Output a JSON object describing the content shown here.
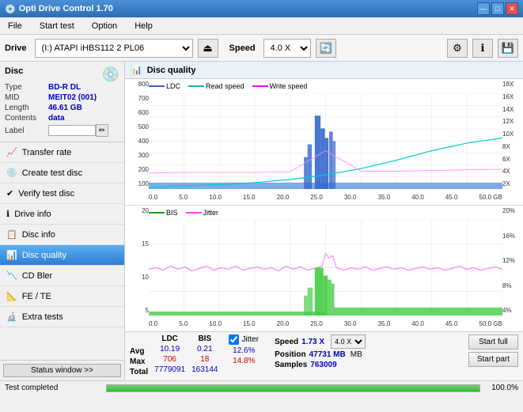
{
  "titleBar": {
    "title": "Opti Drive Control 1.70",
    "icon": "💿",
    "controls": [
      "—",
      "□",
      "✕"
    ]
  },
  "menuBar": {
    "items": [
      "File",
      "Start test",
      "Option",
      "Help"
    ]
  },
  "toolbar": {
    "driveLabel": "Drive",
    "driveValue": "(I:)  ATAPI iHBS112  2 PL06",
    "speedLabel": "Speed",
    "speedValue": "4.0 X"
  },
  "sidebar": {
    "discSection": "Disc",
    "discInfo": {
      "typeLabel": "Type",
      "typeValue": "BD-R DL",
      "midLabel": "MID",
      "midValue": "MEIT02 (001)",
      "lengthLabel": "Length",
      "lengthValue": "46.61 GB",
      "contentsLabel": "Contents",
      "contentsValue": "data",
      "labelLabel": "Label"
    },
    "navItems": [
      {
        "id": "transfer-rate",
        "label": "Transfer rate",
        "icon": "📈"
      },
      {
        "id": "create-test-disc",
        "label": "Create test disc",
        "icon": "💿"
      },
      {
        "id": "verify-test-disc",
        "label": "Verify test disc",
        "icon": "✔"
      },
      {
        "id": "drive-info",
        "label": "Drive info",
        "icon": "ℹ"
      },
      {
        "id": "disc-info",
        "label": "Disc info",
        "icon": "📋"
      },
      {
        "id": "disc-quality",
        "label": "Disc quality",
        "icon": "📊",
        "active": true
      },
      {
        "id": "cd-bler",
        "label": "CD Bler",
        "icon": "📉"
      },
      {
        "id": "fe-te",
        "label": "FE / TE",
        "icon": "📐"
      },
      {
        "id": "extra-tests",
        "label": "Extra tests",
        "icon": "🔬"
      }
    ],
    "statusWindow": "Status window >>",
    "testCompleted": "Test completed"
  },
  "discQuality": {
    "title": "Disc quality",
    "legendTop": {
      "ldc": "LDC",
      "readSpeed": "Read speed",
      "writeSpeed": "Write speed"
    },
    "legendBottom": {
      "bis": "BIS",
      "jitter": "Jitter"
    },
    "topChart": {
      "yMax": 800,
      "yLabels": [
        "800",
        "700",
        "600",
        "500",
        "400",
        "300",
        "200",
        "100"
      ],
      "yLabelsRight": [
        "18X",
        "16X",
        "14X",
        "12X",
        "10X",
        "8X",
        "6X",
        "4X",
        "2X"
      ],
      "xLabels": [
        "0.0",
        "5.0",
        "10.0",
        "15.0",
        "20.0",
        "25.0",
        "30.0",
        "35.0",
        "40.0",
        "45.0",
        "50.0 GB"
      ]
    },
    "bottomChart": {
      "yMax": 20,
      "yLabels": [
        "20",
        "15",
        "10",
        "5"
      ],
      "yLabelsRight": [
        "20%",
        "16%",
        "12%",
        "8%",
        "4%"
      ],
      "xLabels": [
        "0.0",
        "5.0",
        "10.0",
        "15.0",
        "20.0",
        "25.0",
        "30.0",
        "35.0",
        "40.0",
        "45.0",
        "50.0 GB"
      ]
    },
    "stats": {
      "headers": [
        "LDC",
        "BIS",
        "",
        "Jitter",
        "Speed"
      ],
      "avg": {
        "ldc": "10.19",
        "bis": "0.21",
        "jitter": "12.6%",
        "speed": "1.73 X",
        "speedSelect": "4.0 X"
      },
      "max": {
        "ldc": "706",
        "bis": "18",
        "jitter": "14.8%",
        "position": "47731 MB"
      },
      "total": {
        "ldc": "7779091",
        "bis": "163144",
        "samples": "763009"
      },
      "labels": [
        "Avg",
        "Max",
        "Total"
      ],
      "jitterLabel": "Jitter",
      "speedLabel": "Speed",
      "positionLabel": "Position",
      "samplesLabel": "Samples",
      "startFullBtn": "Start full",
      "startPartBtn": "Start part"
    }
  },
  "footer": {
    "statusWindowLabel": "Status window >>",
    "testCompletedLabel": "Test completed",
    "progressPercent": "100.0%",
    "progressFill": 100
  }
}
